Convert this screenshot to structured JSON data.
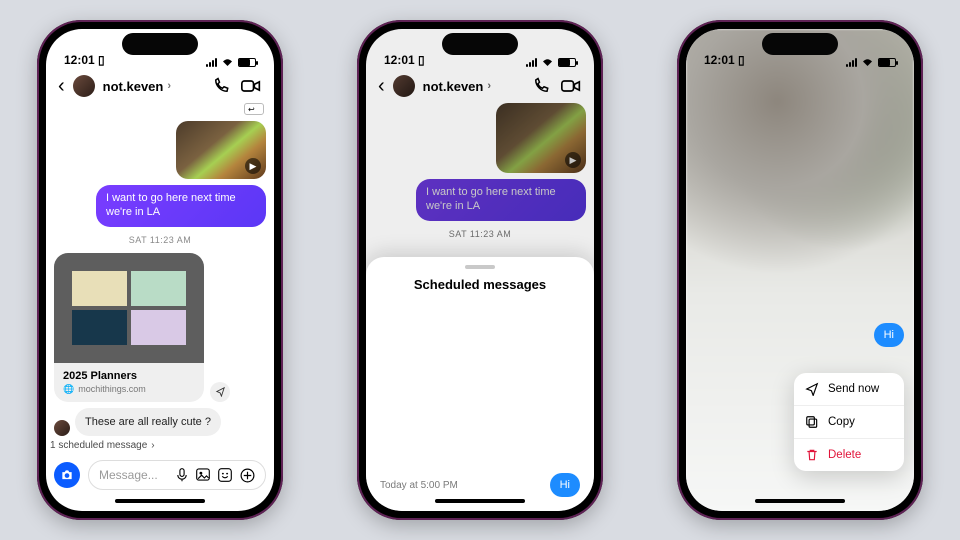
{
  "status": {
    "time": "12:01",
    "after_time_glyph": "▯"
  },
  "header": {
    "username": "not.keven",
    "chevron": "›"
  },
  "chat": {
    "outgoing_text": "I want to go here next time we're in LA",
    "day_label": "SAT 11:23 AM",
    "link_card": {
      "title": "2025 Planners",
      "source": "mochithings.com"
    },
    "incoming_text": "These are all really cute ?",
    "scheduled_banner": "1 scheduled message",
    "scheduled_chevron": "›"
  },
  "composer": {
    "placeholder": "Message..."
  },
  "sheet": {
    "title": "Scheduled messages",
    "timestamp": "Today at 5:00 PM",
    "bubble": "Hi"
  },
  "context_menu": {
    "bubble": "Hi",
    "send_now": "Send now",
    "copy": "Copy",
    "delete": "Delete"
  }
}
